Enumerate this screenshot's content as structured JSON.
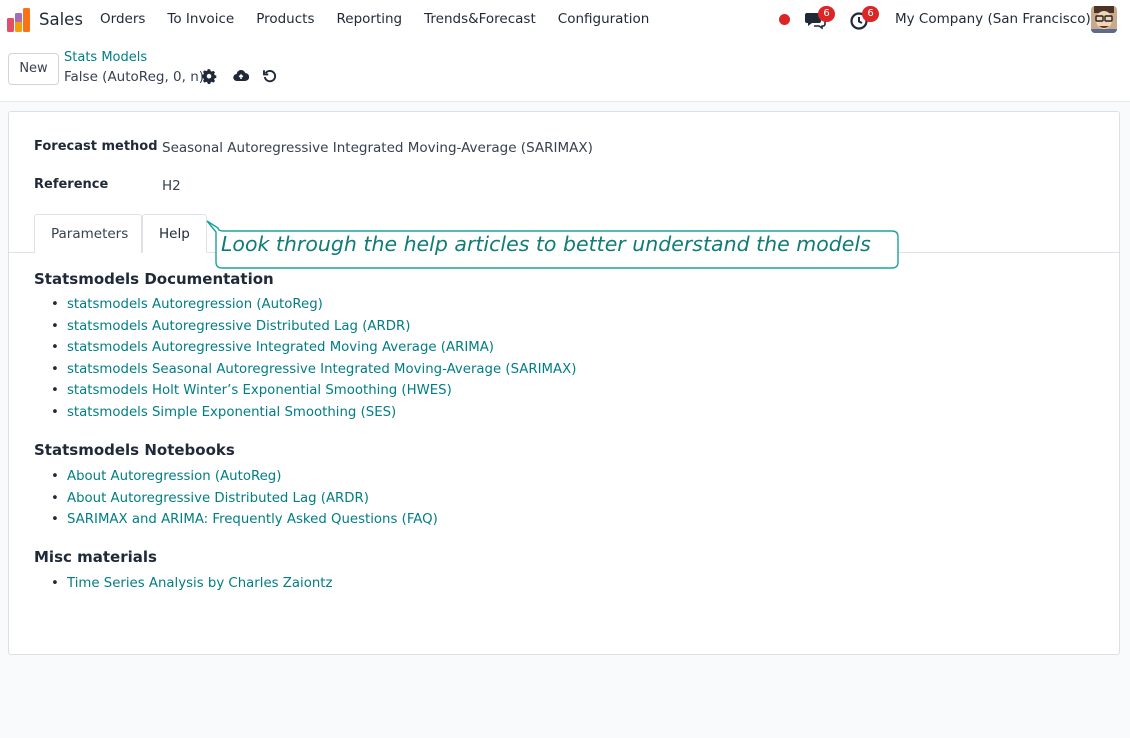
{
  "navbar": {
    "app_name": "Sales",
    "menu": [
      "Orders",
      "To Invoice",
      "Products",
      "Reporting",
      "Trends&Forecast",
      "Configuration"
    ],
    "messages_count": "6",
    "activities_count": "6",
    "company": "My Company (San Francisco)"
  },
  "control_panel": {
    "new_label": "New",
    "breadcrumb": "Stats Models",
    "record_title": "False (AutoReg, 0, n)"
  },
  "form": {
    "forecast_method_label": "Forecast method",
    "forecast_method_value": "Seasonal Autoregressive Integrated Moving-Average (SARIMAX)",
    "reference_label": "Reference",
    "reference_value": "H2",
    "tabs": [
      "Parameters",
      "Help"
    ],
    "active_tab": "Help"
  },
  "help": {
    "sections": [
      {
        "title": "Statsmodels Documentation",
        "links": [
          "statsmodels Autoregression (AutoReg)",
          "statsmodels Autoregressive Distributed Lag (ARDR)",
          "statsmodels Autoregressive Integrated Moving Average (ARIMA)",
          "statsmodels Seasonal Autoregressive Integrated Moving-Average (SARIMAX)",
          "statsmodels Holt Winter’s Exponential Smoothing (HWES)",
          "statsmodels Simple Exponential Smoothing (SES)"
        ]
      },
      {
        "title": "Statsmodels Notebooks",
        "links": [
          "About Autoregression (AutoReg)",
          "About Autoregressive Distributed Lag (ARDR)",
          "SARIMAX and ARIMA: Frequently Asked Questions (FAQ)"
        ]
      },
      {
        "title": "Misc materials",
        "links": [
          "Time Series Analysis by Charles Zaiontz"
        ]
      }
    ]
  },
  "callout": {
    "text": "Look through the help articles to better understand the models"
  },
  "colors": {
    "link": "#017e84",
    "badge": "#dc2626",
    "callout": "#0f7c78"
  }
}
